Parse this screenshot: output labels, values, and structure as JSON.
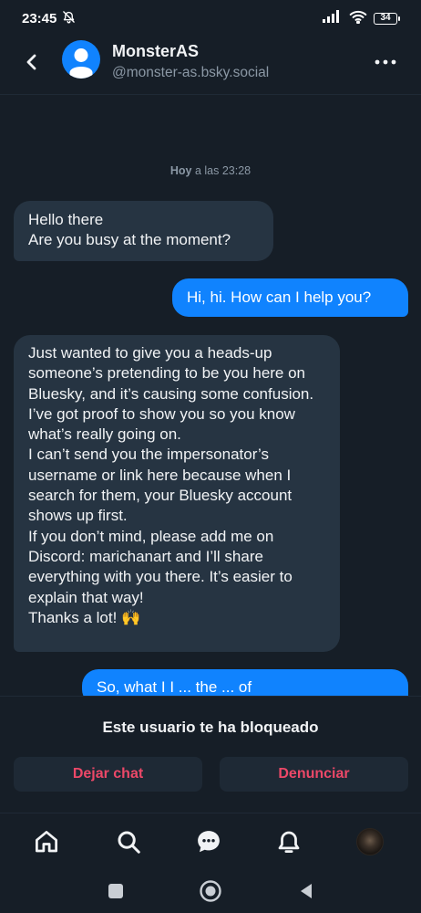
{
  "status_bar": {
    "time": "23:45",
    "battery": "34"
  },
  "header": {
    "name": "MonsterAS",
    "handle": "@monster-as.bsky.social"
  },
  "chat": {
    "timestamp_day": "Hoy",
    "timestamp_rest": " a las 23:28",
    "messages": [
      {
        "from": "them",
        "text": "Hello there\nAre you busy at the moment?"
      },
      {
        "from": "me",
        "text": "Hi, hi. How can I help you?"
      },
      {
        "from": "them",
        "text": "Just wanted to give you a heads-up someone’s pretending to be you here on Bluesky, and it’s causing some confusion. I’ve got proof to show you so you know what’s really going on.\nI can’t send you the impersonator’s username or link here because when I search for them, your Bluesky account shows up first.\nIf you don’t mind, please add me on Discord: marichanart and I’ll share everything with you there. It’s easier to explain that way!\nThanks a lot! 🙌"
      },
      {
        "from": "me",
        "text": "So, what I I ... the ... of"
      }
    ]
  },
  "blocked": {
    "message": "Este usuario te ha bloqueado",
    "leave_label": "Dejar chat",
    "report_label": "Denunciar"
  },
  "bottom_nav": {
    "items": [
      "home-icon",
      "search-icon",
      "chat-icon",
      "bell-icon",
      "profile-avatar"
    ]
  },
  "colors": {
    "background": "#161e27",
    "incoming_bubble": "#263442",
    "outgoing_bubble": "#1083fe",
    "danger": "#ec4868"
  }
}
